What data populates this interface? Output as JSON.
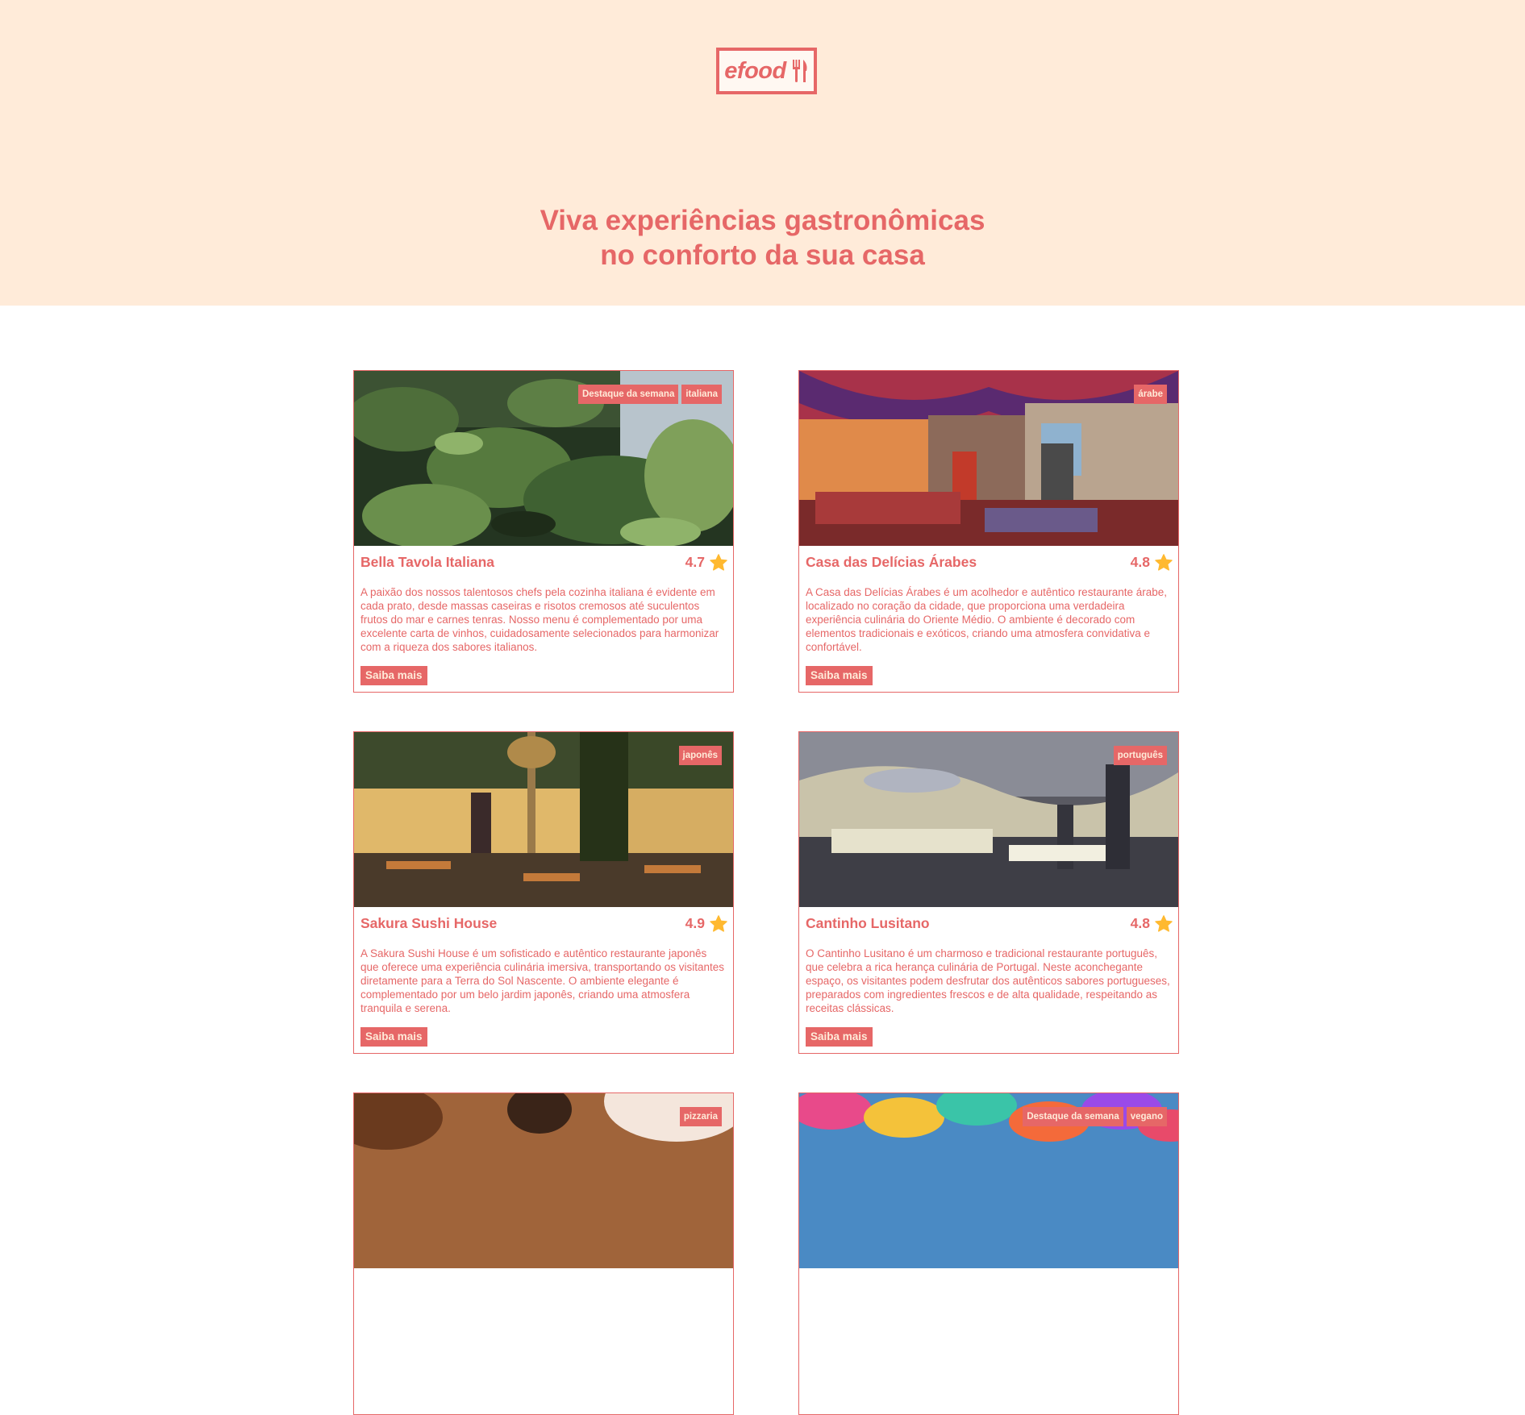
{
  "header": {
    "logo_text": "efood",
    "tagline_line1": "Viva experiências gastronômicas",
    "tagline_line2": "no conforto da sua casa"
  },
  "colors": {
    "accent": "#e66767",
    "hero_bg": "#ffebd9",
    "star": "#ffb930"
  },
  "restaurants": [
    {
      "name": "Bella Tavola Italiana",
      "rating": "4.7",
      "tags": [
        "Destaque da semana",
        "italiana"
      ],
      "description": "A paixão dos nossos talentosos chefs pela cozinha italiana é evidente em cada prato, desde massas caseiras e risotos cremosos até suculentos frutos do mar e carnes tenras. Nosso menu é complementado por uma excelente carta de vinhos, cuidadosamente selecionados para harmonizar com a riqueza dos sabores italianos.",
      "button": "Saiba mais"
    },
    {
      "name": "Casa das Delícias Árabes",
      "rating": "4.8",
      "tags": [
        "árabe"
      ],
      "description": "A Casa das Delícias Árabes é um acolhedor e autêntico restaurante árabe, localizado no coração da cidade, que proporciona uma verdadeira experiência culinária do Oriente Médio. O ambiente é decorado com elementos tradicionais e exóticos, criando uma atmosfera convidativa e confortável.",
      "button": "Saiba mais"
    },
    {
      "name": "Sakura Sushi House",
      "rating": "4.9",
      "tags": [
        "japonês"
      ],
      "description": "A Sakura Sushi House é um sofisticado e autêntico restaurante japonês que oferece uma experiência culinária imersiva, transportando os visitantes diretamente para a Terra do Sol Nascente. O ambiente elegante é complementado por um belo jardim japonês, criando uma atmosfera tranquila e serena.",
      "button": "Saiba mais"
    },
    {
      "name": "Cantinho Lusitano",
      "rating": "4.8",
      "tags": [
        "português"
      ],
      "description": "O Cantinho Lusitano é um charmoso e tradicional restaurante português, que celebra a rica herança culinária de Portugal. Neste aconchegante espaço, os visitantes podem desfrutar dos autênticos sabores portugueses, preparados com ingredientes frescos e de alta qualidade, respeitando as receitas clássicas.",
      "button": "Saiba mais"
    },
    {
      "tags": [
        "pizzaria"
      ]
    },
    {
      "tags": [
        "Destaque da semana",
        "vegano"
      ]
    }
  ]
}
